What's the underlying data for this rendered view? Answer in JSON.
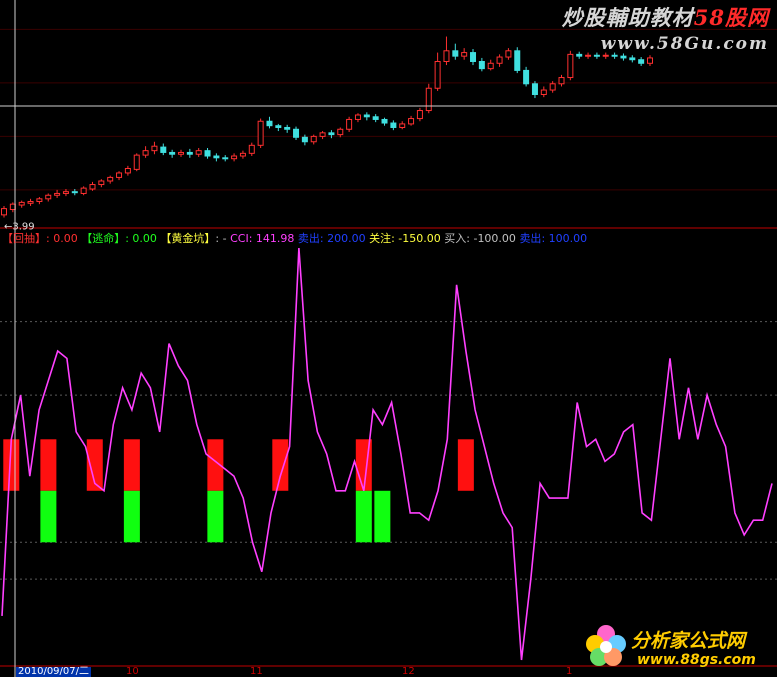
{
  "watermark": {
    "line1_prefix": "炒股輔助教材",
    "line1_brand": "58股网",
    "line2": "www.58Gu.com",
    "logo_line1": "分析家公式网",
    "logo_line2": "www.88gs.com"
  },
  "price_panel": {
    "low_marker": "3.99"
  },
  "legend": {
    "items": [
      {
        "label": "【回抽】",
        "value": ": 0.00",
        "label_color": "#ff3030",
        "value_color": "#ff3030"
      },
      {
        "label": "【逃命】",
        "value": ": 0.00",
        "label_color": "#20ff20",
        "value_color": "#20ff20"
      },
      {
        "label": "【黄金坑】",
        "value": ": -",
        "label_color": "#ffff40",
        "value_color": "#c0c0c0"
      },
      {
        "label": "  CCI",
        "value": ": 141.98",
        "label_color": "#ff40ff",
        "value_color": "#ff40ff"
      },
      {
        "label": "  卖出",
        "value": ": 200.00",
        "label_color": "#2040ff",
        "value_color": "#2040ff"
      },
      {
        "label": "  关注",
        "value": ": -150.00",
        "label_color": "#ffff40",
        "value_color": "#ffff40"
      },
      {
        "label": "  买入",
        "value": ": -100.00",
        "label_color": "#c0c0c0",
        "value_color": "#c0c0c0"
      },
      {
        "label": "  卖出",
        "value": ": 100.00",
        "label_color": "#2040ff",
        "value_color": "#2040ff"
      }
    ]
  },
  "date_axis": {
    "cursor_date": "2010/09/07/二",
    "months": [
      "10",
      "11",
      "12",
      "1"
    ]
  },
  "colors": {
    "up": "#ff3030",
    "down": "#40e0e0",
    "cci_line": "#ff40ff",
    "red_bar": "#ff1010",
    "green_bar": "#10ff10",
    "panel_border": "#c00000"
  },
  "chart_data": [
    {
      "type": "candlestick",
      "title": "",
      "ylim": [
        3.9,
        6.3
      ],
      "candles": [
        [
          3.98,
          4.05,
          4.08,
          3.95
        ],
        [
          4.04,
          4.1,
          4.12,
          4.01
        ],
        [
          4.09,
          4.12,
          4.14,
          4.06
        ],
        [
          4.11,
          4.13,
          4.16,
          4.08
        ],
        [
          4.13,
          4.16,
          4.18,
          4.1
        ],
        [
          4.16,
          4.2,
          4.22,
          4.13
        ],
        [
          4.2,
          4.22,
          4.26,
          4.17
        ],
        [
          4.22,
          4.24,
          4.27,
          4.19
        ],
        [
          4.24,
          4.23,
          4.27,
          4.2
        ],
        [
          4.22,
          4.28,
          4.3,
          4.2
        ],
        [
          4.27,
          4.32,
          4.35,
          4.25
        ],
        [
          4.32,
          4.36,
          4.38,
          4.29
        ],
        [
          4.36,
          4.4,
          4.42,
          4.33
        ],
        [
          4.4,
          4.45,
          4.47,
          4.37
        ],
        [
          4.45,
          4.5,
          4.53,
          4.42
        ],
        [
          4.49,
          4.65,
          4.67,
          4.47
        ],
        [
          4.65,
          4.7,
          4.75,
          4.62
        ],
        [
          4.7,
          4.75,
          4.8,
          4.66
        ],
        [
          4.74,
          4.68,
          4.78,
          4.65
        ],
        [
          4.68,
          4.66,
          4.71,
          4.62
        ],
        [
          4.66,
          4.68,
          4.71,
          4.63
        ],
        [
          4.68,
          4.66,
          4.72,
          4.62
        ],
        [
          4.66,
          4.7,
          4.73,
          4.63
        ],
        [
          4.7,
          4.64,
          4.73,
          4.61
        ],
        [
          4.64,
          4.62,
          4.67,
          4.58
        ],
        [
          4.62,
          4.61,
          4.65,
          4.58
        ],
        [
          4.61,
          4.64,
          4.67,
          4.58
        ],
        [
          4.64,
          4.67,
          4.7,
          4.61
        ],
        [
          4.67,
          4.76,
          4.79,
          4.64
        ],
        [
          4.76,
          5.03,
          5.06,
          4.73
        ],
        [
          5.03,
          4.98,
          5.08,
          4.95
        ],
        [
          4.98,
          4.96,
          5.0,
          4.92
        ],
        [
          4.96,
          4.94,
          4.99,
          4.9
        ],
        [
          4.94,
          4.85,
          4.97,
          4.82
        ],
        [
          4.85,
          4.8,
          4.88,
          4.76
        ],
        [
          4.8,
          4.86,
          4.88,
          4.77
        ],
        [
          4.86,
          4.9,
          4.92,
          4.83
        ],
        [
          4.9,
          4.88,
          4.93,
          4.84
        ],
        [
          4.88,
          4.94,
          4.96,
          4.85
        ],
        [
          4.94,
          5.05,
          5.08,
          4.91
        ],
        [
          5.05,
          5.1,
          5.12,
          5.02
        ],
        [
          5.1,
          5.08,
          5.13,
          5.04
        ],
        [
          5.08,
          5.05,
          5.11,
          5.02
        ],
        [
          5.05,
          5.01,
          5.07,
          4.98
        ],
        [
          5.01,
          4.96,
          5.04,
          4.93
        ],
        [
          4.96,
          5.0,
          5.03,
          4.94
        ],
        [
          5.0,
          5.06,
          5.09,
          4.98
        ],
        [
          5.06,
          5.15,
          5.18,
          5.03
        ],
        [
          5.15,
          5.4,
          5.45,
          5.12
        ],
        [
          5.4,
          5.7,
          5.8,
          5.37
        ],
        [
          5.7,
          5.82,
          5.98,
          5.66
        ],
        [
          5.82,
          5.76,
          5.9,
          5.72
        ],
        [
          5.76,
          5.8,
          5.85,
          5.72
        ],
        [
          5.8,
          5.7,
          5.84,
          5.66
        ],
        [
          5.7,
          5.62,
          5.74,
          5.59
        ],
        [
          5.62,
          5.68,
          5.72,
          5.6
        ],
        [
          5.68,
          5.75,
          5.78,
          5.64
        ],
        [
          5.75,
          5.82,
          5.85,
          5.72
        ],
        [
          5.82,
          5.6,
          5.86,
          5.57
        ],
        [
          5.6,
          5.45,
          5.64,
          5.42
        ],
        [
          5.45,
          5.33,
          5.48,
          5.29
        ],
        [
          5.33,
          5.38,
          5.42,
          5.3
        ],
        [
          5.38,
          5.45,
          5.48,
          5.35
        ],
        [
          5.45,
          5.52,
          5.55,
          5.42
        ],
        [
          5.52,
          5.78,
          5.82,
          5.49
        ],
        [
          5.78,
          5.76,
          5.81,
          5.73
        ],
        [
          5.76,
          5.77,
          5.8,
          5.73
        ],
        [
          5.77,
          5.76,
          5.8,
          5.73
        ],
        [
          5.76,
          5.77,
          5.8,
          5.73
        ],
        [
          5.77,
          5.76,
          5.8,
          5.73
        ],
        [
          5.76,
          5.74,
          5.79,
          5.71
        ],
        [
          5.74,
          5.72,
          5.77,
          5.69
        ],
        [
          5.72,
          5.68,
          5.75,
          5.65
        ],
        [
          5.68,
          5.74,
          5.77,
          5.65
        ]
      ]
    },
    {
      "type": "line",
      "title": "",
      "series_name": "CCI",
      "ylim": [
        -260,
        300
      ],
      "reference_lines": [
        200,
        100,
        -100,
        -150
      ],
      "values": [
        -200,
        40,
        100,
        -10,
        80,
        120,
        160,
        150,
        50,
        30,
        -20,
        -30,
        60,
        110,
        80,
        130,
        110,
        50,
        170,
        140,
        120,
        60,
        20,
        10,
        0,
        -10,
        -40,
        -100,
        -140,
        -60,
        -10,
        30,
        300,
        120,
        50,
        20,
        -30,
        -30,
        10,
        -30,
        80,
        60,
        90,
        20,
        -60,
        -60,
        -70,
        -30,
        40,
        250,
        160,
        80,
        30,
        -20,
        -60,
        -80,
        -260,
        -150,
        -20,
        -40,
        -40,
        -40,
        90,
        30,
        40,
        10,
        20,
        50,
        60,
        -60,
        -70,
        40,
        150,
        40,
        110,
        40,
        100,
        60,
        30,
        -60,
        -90,
        -70,
        -70,
        -20
      ],
      "red_bars": [
        1,
        5,
        10,
        14,
        23,
        30,
        39,
        50
      ],
      "green_bars": [
        5,
        14,
        23,
        39,
        41
      ]
    }
  ]
}
